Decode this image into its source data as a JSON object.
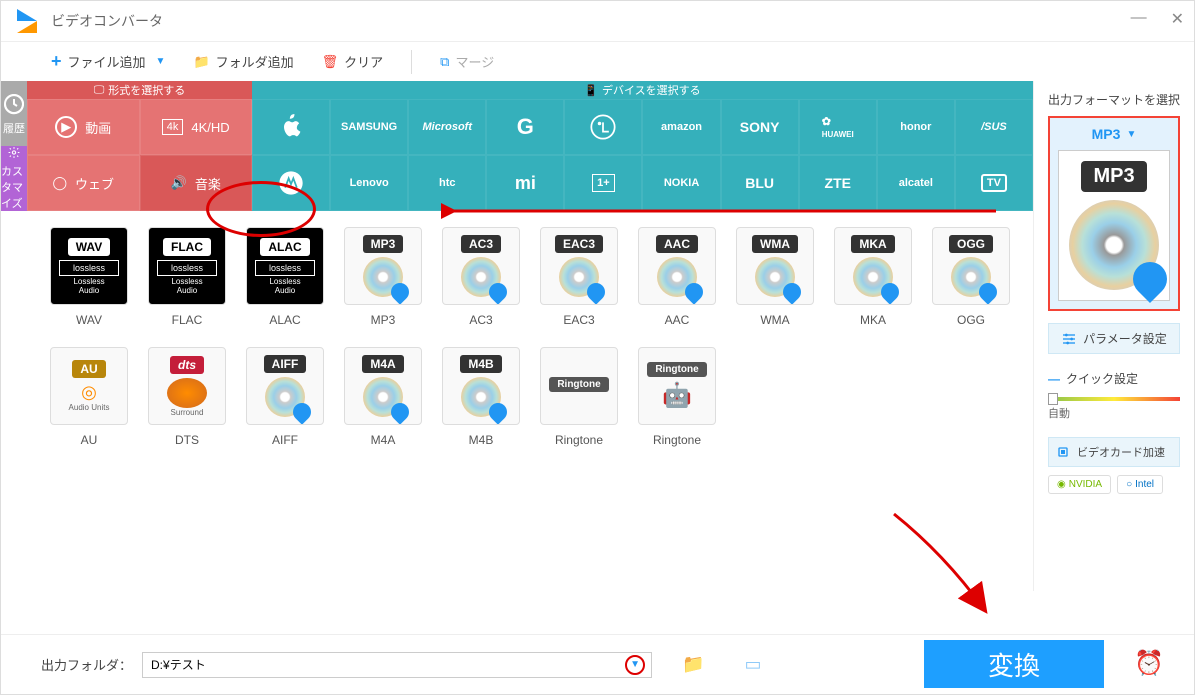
{
  "title": "ビデオコンバータ",
  "toolbar": {
    "add_file": "ファイル追加",
    "add_folder": "フォルダ追加",
    "clear": "クリア",
    "merge": "マージ"
  },
  "sidebar": {
    "history": "履歴",
    "customize": "カスタマイズ"
  },
  "tabs": {
    "format": "形式を選択する",
    "device": "デバイスを選択する"
  },
  "categories": {
    "video": "動画",
    "hd": "4K/HD",
    "web": "ウェブ",
    "music": "音楽"
  },
  "brands": [
    "Apple",
    "SAMSUNG",
    "Microsoft",
    "G",
    "LG",
    "amazon",
    "SONY",
    "HUAWEI",
    "honor",
    "ASUS",
    "Motorola",
    "Lenovo",
    "htc",
    "mi",
    "OnePlus",
    "NOKIA",
    "BLU",
    "ZTE",
    "alcatel",
    "TV"
  ],
  "formats_row1": [
    {
      "code": "WAV",
      "name": "WAV",
      "lossless": true
    },
    {
      "code": "FLAC",
      "name": "FLAC",
      "lossless": true
    },
    {
      "code": "ALAC",
      "name": "ALAC",
      "lossless": true
    },
    {
      "code": "MP3",
      "name": "MP3"
    },
    {
      "code": "AC3",
      "name": "AC3"
    },
    {
      "code": "EAC3",
      "name": "EAC3"
    },
    {
      "code": "AAC",
      "name": "AAC"
    },
    {
      "code": "WMA",
      "name": "WMA"
    },
    {
      "code": "MKA",
      "name": "MKA"
    },
    {
      "code": "OGG",
      "name": "OGG"
    }
  ],
  "formats_row2": [
    {
      "code": "AU",
      "name": "AU",
      "special": "au"
    },
    {
      "code": "dts",
      "name": "DTS",
      "special": "dts"
    },
    {
      "code": "AIFF",
      "name": "AIFF"
    },
    {
      "code": "M4A",
      "name": "M4A"
    },
    {
      "code": "M4B",
      "name": "M4B"
    },
    {
      "code": "Ringtone",
      "name": "Ringtone",
      "special": "apple"
    },
    {
      "code": "Ringtone",
      "name": "Ringtone",
      "special": "android"
    }
  ],
  "right": {
    "title": "出力フォーマットを選択",
    "selected": "MP3",
    "big_label": "MP3",
    "param": "パラメータ設定",
    "quick": "クイック設定",
    "auto": "自動",
    "gpu": "ビデオカード加速",
    "nvidia": "NVIDIA",
    "intel": "Intel"
  },
  "bottom": {
    "label": "出力フォルダ：",
    "path": "D:¥テスト",
    "convert": "変換"
  }
}
